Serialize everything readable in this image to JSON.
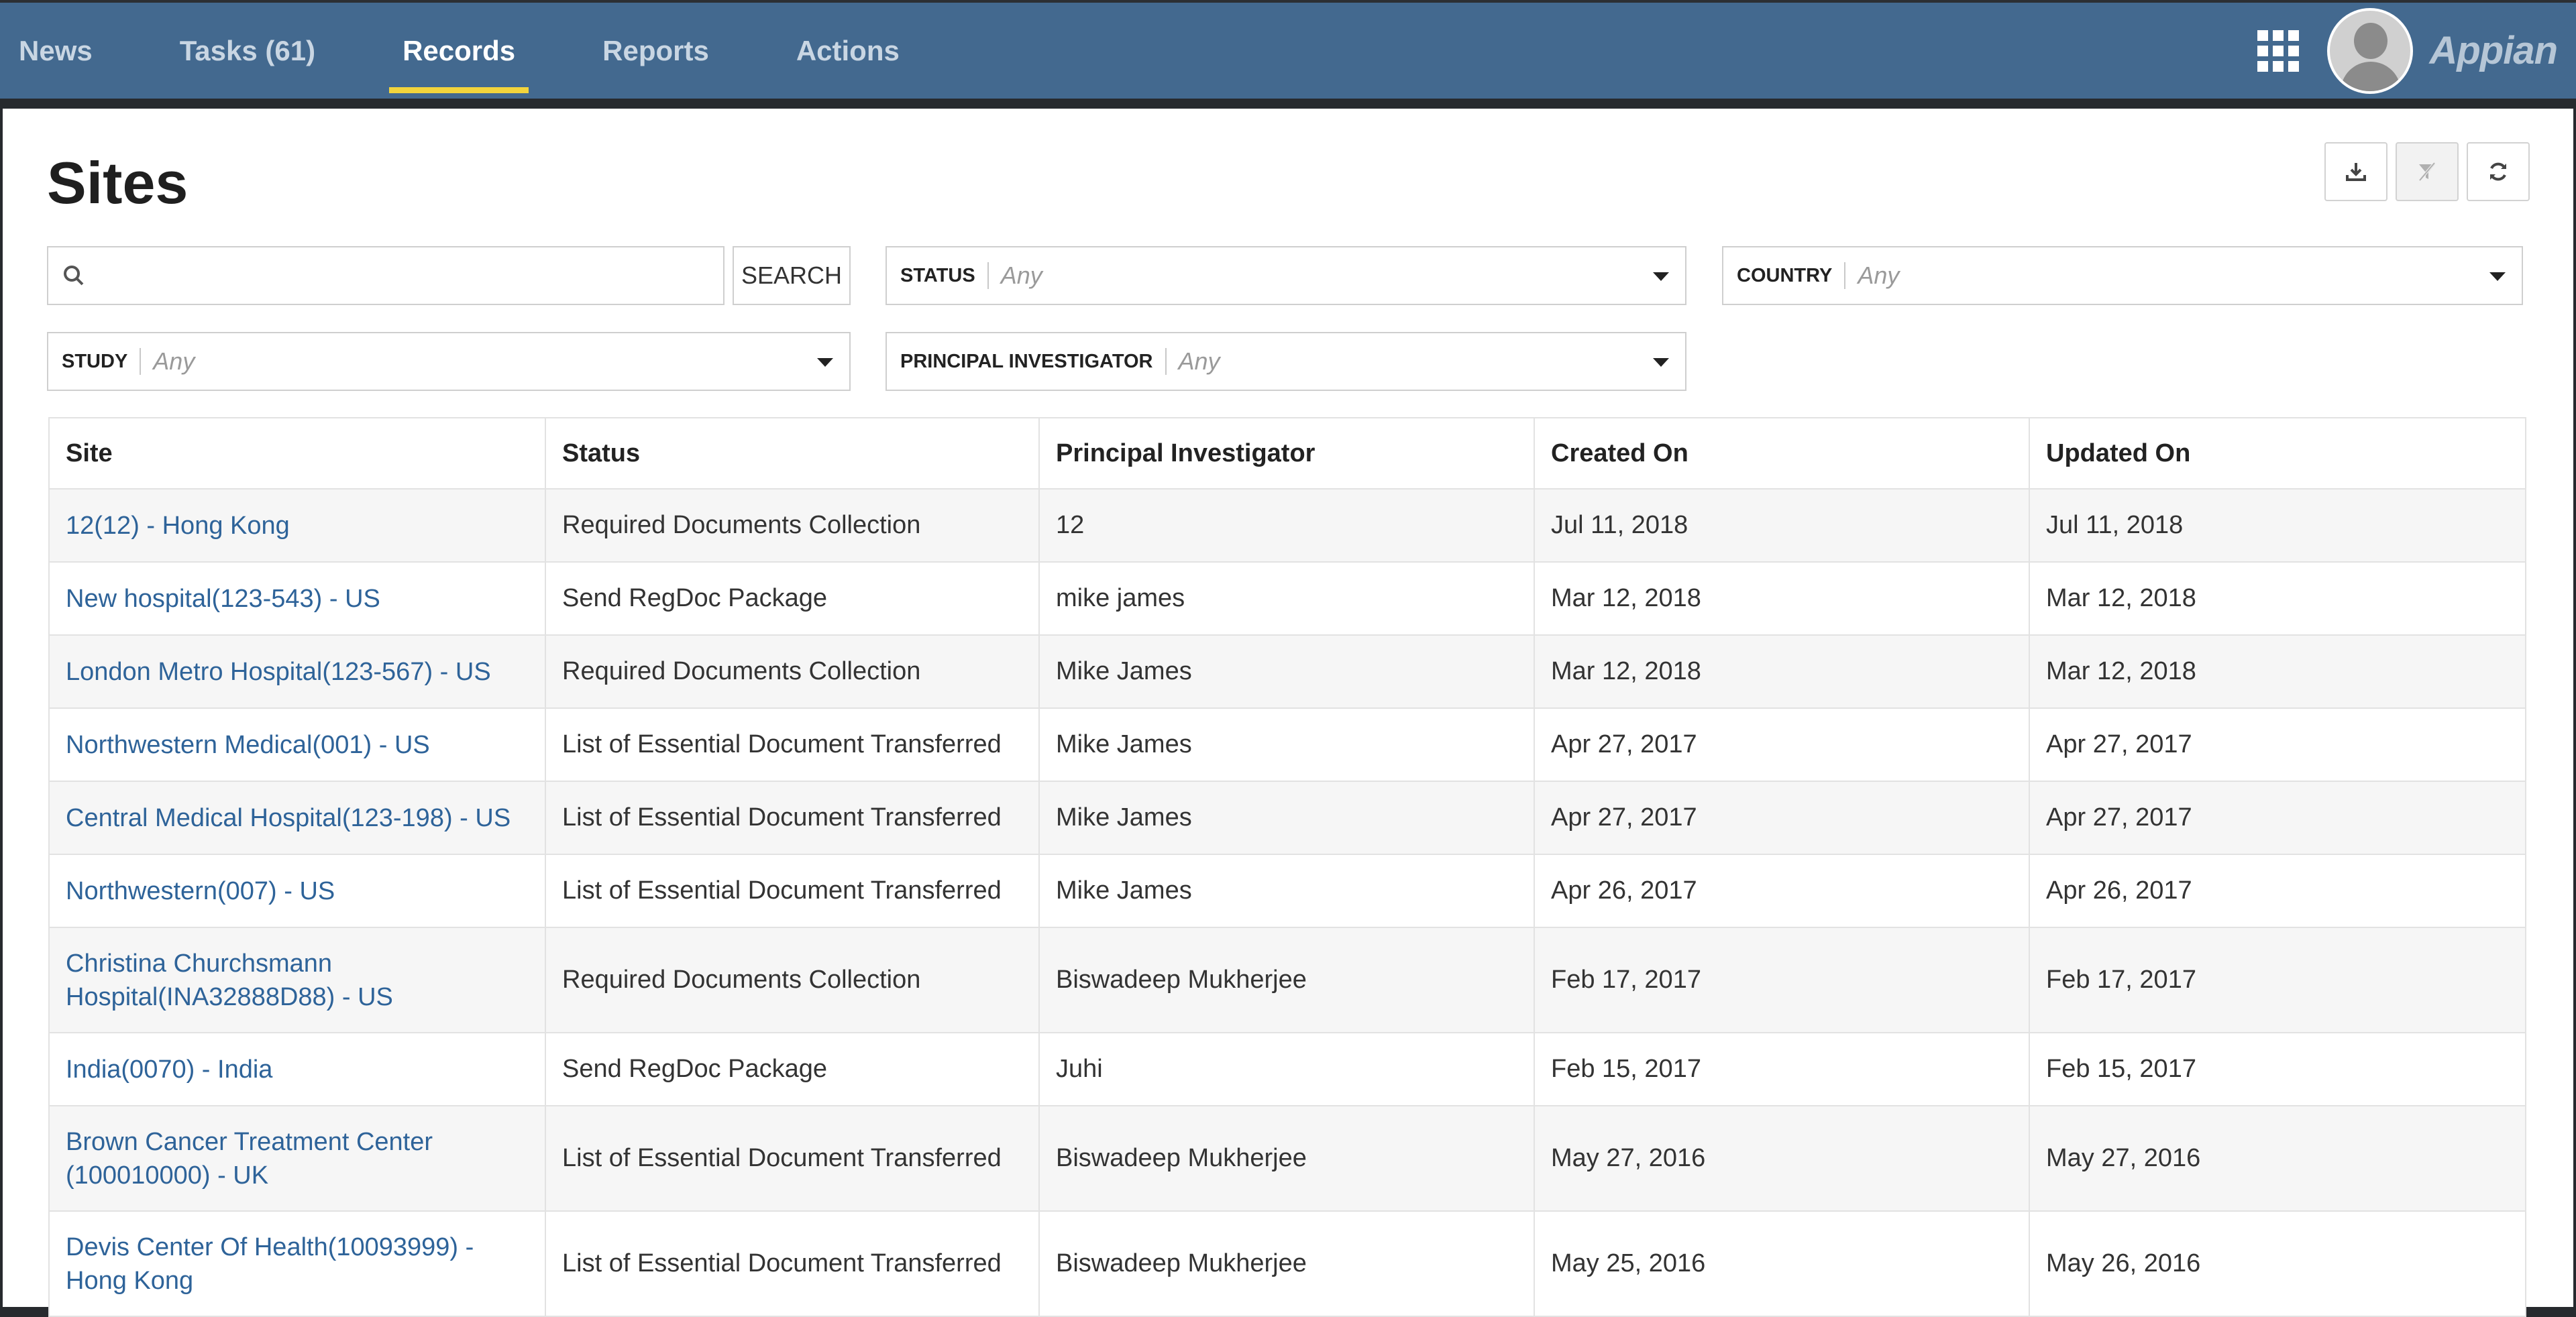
{
  "nav": {
    "items": [
      {
        "label": "News",
        "active": false
      },
      {
        "label": "Tasks (61)",
        "active": false
      },
      {
        "label": "Records",
        "active": true
      },
      {
        "label": "Reports",
        "active": false
      },
      {
        "label": "Actions",
        "active": false
      }
    ],
    "brand": "Appian",
    "accent_color": "#f2d43c",
    "bar_color": "#43698f"
  },
  "page": {
    "title": "Sites"
  },
  "toolbar": {
    "icons": [
      "download-icon",
      "clear-filters-icon",
      "refresh-icon"
    ]
  },
  "filters": {
    "search": {
      "value": "",
      "button_label": "SEARCH"
    },
    "status": {
      "label": "STATUS",
      "value": "Any"
    },
    "country": {
      "label": "COUNTRY",
      "value": "Any"
    },
    "study": {
      "label": "STUDY",
      "value": "Any"
    },
    "principal_investigator": {
      "label": "PRINCIPAL INVESTIGATOR",
      "value": "Any"
    }
  },
  "table": {
    "columns": [
      "Site",
      "Status",
      "Principal Investigator",
      "Created On",
      "Updated On"
    ],
    "rows": [
      {
        "site": "12(12) - Hong Kong",
        "status": "Required Documents Collection",
        "pi": "12",
        "created": "Jul 11, 2018",
        "updated": "Jul 11, 2018"
      },
      {
        "site": "New hospital(123-543) - US",
        "status": "Send RegDoc Package",
        "pi": "mike james",
        "created": "Mar 12, 2018",
        "updated": "Mar 12, 2018"
      },
      {
        "site": "London Metro Hospital(123-567) - US",
        "status": "Required Documents Collection",
        "pi": "Mike James",
        "created": "Mar 12, 2018",
        "updated": "Mar 12, 2018"
      },
      {
        "site": "Northwestern Medical(001) - US",
        "status": "List of Essential Document Transferred",
        "pi": "Mike James",
        "created": "Apr 27, 2017",
        "updated": "Apr 27, 2017"
      },
      {
        "site": "Central Medical Hospital(123-198) - US",
        "status": "List of Essential Document Transferred",
        "pi": "Mike James",
        "created": "Apr 27, 2017",
        "updated": "Apr 27, 2017"
      },
      {
        "site": "Northwestern(007) - US",
        "status": "List of Essential Document Transferred",
        "pi": "Mike James",
        "created": "Apr 26, 2017",
        "updated": "Apr 26, 2017"
      },
      {
        "site": "Christina Churchsmann Hospital(INA32888D88) - US",
        "status": "Required Documents Collection",
        "pi": "Biswadeep Mukherjee",
        "created": "Feb 17, 2017",
        "updated": "Feb 17, 2017"
      },
      {
        "site": "India(0070) - India",
        "status": "Send RegDoc Package",
        "pi": "Juhi",
        "created": "Feb 15, 2017",
        "updated": "Feb 15, 2017"
      },
      {
        "site": "Brown Cancer Treatment Center (100010000) - UK",
        "status": "List of Essential Document Transferred",
        "pi": "Biswadeep Mukherjee",
        "created": "May 27, 2016",
        "updated": "May 27, 2016"
      },
      {
        "site": "Devis Center Of Health(10093999) - Hong Kong",
        "status": "List of Essential Document Transferred",
        "pi": "Biswadeep Mukherjee",
        "created": "May 25, 2016",
        "updated": "May 26, 2016"
      }
    ]
  }
}
